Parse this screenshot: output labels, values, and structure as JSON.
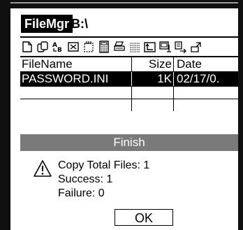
{
  "app": {
    "title": "FileMgr",
    "drive": "B:\\"
  },
  "toolbar": {
    "buttons": [
      {
        "icon": "new-file-icon"
      },
      {
        "icon": "copy-icon"
      },
      {
        "icon": "rename-icon"
      },
      {
        "icon": "delete-icon"
      },
      {
        "icon": "select-icon"
      },
      {
        "icon": "calculator-icon"
      },
      {
        "icon": "print-icon"
      },
      {
        "icon": "list-icon"
      },
      {
        "icon": "up-folder-icon"
      },
      {
        "icon": "properties-icon"
      },
      {
        "icon": "send-icon"
      },
      {
        "icon": "exit-icon"
      }
    ]
  },
  "table": {
    "headers": {
      "name": "FileName",
      "size": "Size",
      "date": "Date"
    },
    "rows": [
      {
        "name": "PASSWORD.INI",
        "size": "1K",
        "date": "02/17/0."
      }
    ]
  },
  "dialog": {
    "title": "Finish",
    "lines": [
      "Copy Total Files: 1",
      "Success: 1",
      "Failure: 0"
    ],
    "ok_label": "OK"
  }
}
